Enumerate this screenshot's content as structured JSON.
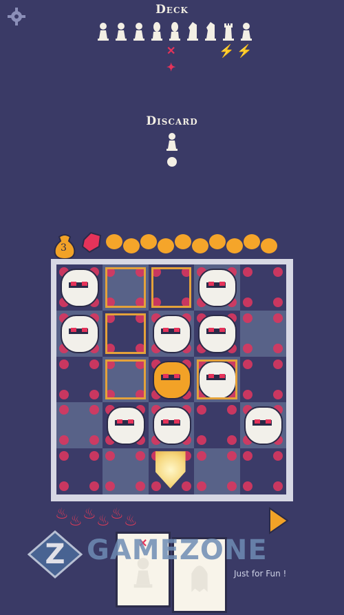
{
  "header": {
    "deck_title": "Deck",
    "discard_title": "Discard",
    "settings_icon": "gear-icon"
  },
  "deck": {
    "pieces": [
      "pawn",
      "pawn",
      "pawn",
      "bishop",
      "bishop",
      "knight",
      "knight",
      "rook",
      "pawn"
    ],
    "deck_modifiers": [
      {
        "icon": "cross-icon",
        "under_index": 4
      },
      {
        "icon": "spark-icon",
        "under_index": 4
      },
      {
        "icon": "bolt-icon",
        "under_index": 7
      },
      {
        "icon": "bolt-icon",
        "under_index": 8
      }
    ]
  },
  "discard": {
    "pieces": [
      "pawn"
    ]
  },
  "resources": {
    "coins_count": "3",
    "gem_icon": "gem-icon",
    "coin_row_count": 10
  },
  "board": {
    "size": 5,
    "highlighted_cells": [
      "1,0",
      "2,0",
      "1,1",
      "1,2",
      "3,2"
    ],
    "units": [
      {
        "cell": "0,0",
        "type": "enemy",
        "name": "red-skull-enemy"
      },
      {
        "cell": "3,0",
        "type": "enemy",
        "name": "helmet-enemy"
      },
      {
        "cell": "0,1",
        "type": "enemy",
        "name": "goblin-enemy"
      },
      {
        "cell": "2,1",
        "type": "enemy",
        "name": "horned-knight-enemy"
      },
      {
        "cell": "3,1",
        "type": "enemy",
        "name": "robot-enemy"
      },
      {
        "cell": "2,2",
        "type": "enemy",
        "name": "gold-king-enemy"
      },
      {
        "cell": "3,2",
        "type": "enemy",
        "name": "furry-beast-enemy"
      },
      {
        "cell": "1,3",
        "type": "enemy",
        "name": "knight-helmet-enemy"
      },
      {
        "cell": "2,3",
        "type": "enemy",
        "name": "visor-helmet-enemy"
      },
      {
        "cell": "4,3",
        "type": "enemy",
        "name": "white-beast-enemy"
      },
      {
        "cell": "2,4",
        "type": "player",
        "name": "glowing-shield"
      }
    ]
  },
  "hand": {
    "hp_fires": 6,
    "cards": [
      {
        "piece": "pawn",
        "marked": true
      },
      {
        "piece": "ghost",
        "marked": false
      }
    ],
    "end_turn_icon": "arrow-right-icon"
  },
  "watermark": {
    "brand": "GAMEZONE",
    "tagline": "Just for Fun !"
  },
  "colors": {
    "background": "#3a3a66",
    "accent_red": "#e5335a",
    "accent_gold": "#f2a227",
    "cell_dark": "#3b3b68",
    "cell_light": "#586288"
  }
}
